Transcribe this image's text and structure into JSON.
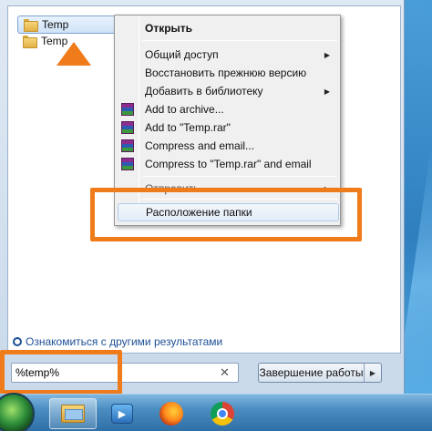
{
  "start_menu": {
    "results": [
      {
        "label": "Temp",
        "selected": true
      },
      {
        "label": "Temp",
        "selected": false
      }
    ],
    "see_more": "Ознакомиться с другими результатами",
    "search": {
      "value": "%temp%",
      "clear_glyph": "✕"
    },
    "shutdown": {
      "label": "Завершение работы",
      "caret_glyph": "▶"
    }
  },
  "context_menu": {
    "items": [
      {
        "label": "Открыть",
        "bold": true,
        "submenu": false,
        "icon": ""
      },
      {
        "label": "Общий доступ",
        "bold": false,
        "submenu": true,
        "icon": ""
      },
      {
        "label": "Восстановить прежнюю версию",
        "bold": false,
        "submenu": false,
        "icon": ""
      },
      {
        "label": "Добавить в библиотеку",
        "bold": false,
        "submenu": true,
        "icon": ""
      },
      {
        "label": "Add to archive...",
        "bold": false,
        "submenu": false,
        "icon": "winrar-icon"
      },
      {
        "label": "Add to \"Temp.rar\"",
        "bold": false,
        "submenu": false,
        "icon": "winrar-icon"
      },
      {
        "label": "Compress and email...",
        "bold": false,
        "submenu": false,
        "icon": "winrar-icon"
      },
      {
        "label": "Compress to \"Temp.rar\" and email",
        "bold": false,
        "submenu": false,
        "icon": "winrar-icon"
      },
      {
        "label": "Отправить",
        "bold": false,
        "submenu": true,
        "icon": ""
      },
      {
        "label": "Расположение папки",
        "bold": false,
        "submenu": false,
        "icon": ""
      }
    ],
    "submenu_glyph": "▶"
  },
  "annotations": {
    "highlight_color": "#f07b1a"
  },
  "taskbar": {
    "media_glyph": "▶"
  }
}
